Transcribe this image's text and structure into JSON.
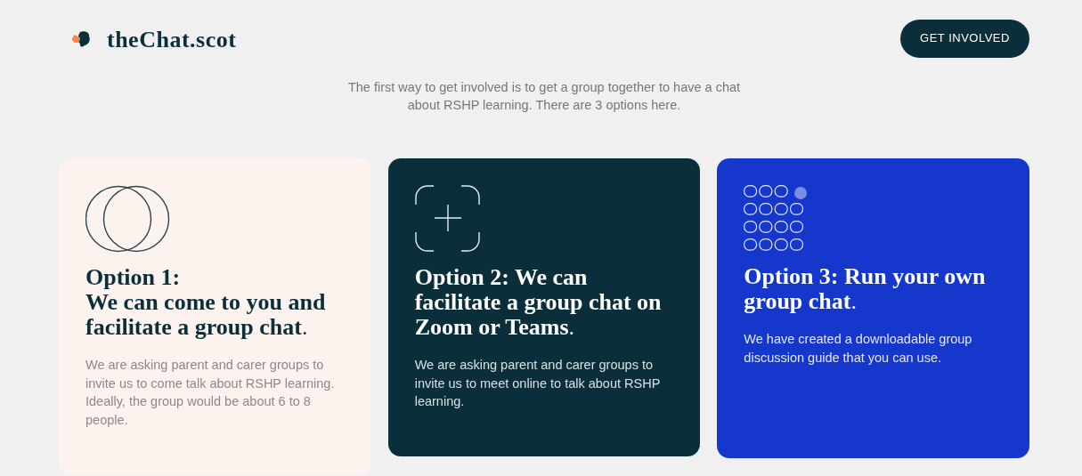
{
  "header": {
    "logo_text": "theChat.scot",
    "button": "GET INVOLVED"
  },
  "intro": "The first way to get involved is to get a group together to have a chat about RSHP learning. There are 3 options here.",
  "cards": [
    {
      "kind": "circles",
      "title": "**Option 1:\nWe can come to you and facilitate a group chat**.",
      "text": "We are asking parent and carer groups to invite us to come talk about RSHP learning. Ideally, the group would be about 6 to 8 people."
    },
    {
      "kind": "frame",
      "title": "**Option 2: We can facilitate a group chat on Zoom or Teams**.",
      "text": "We are asking parent and carer groups to invite us to meet online to talk about RSHP learning."
    },
    {
      "kind": "dots",
      "title": "**Option 3: Run your own group chat**.",
      "text": "We have created a downloadable group discussion guide that you can use."
    }
  ]
}
